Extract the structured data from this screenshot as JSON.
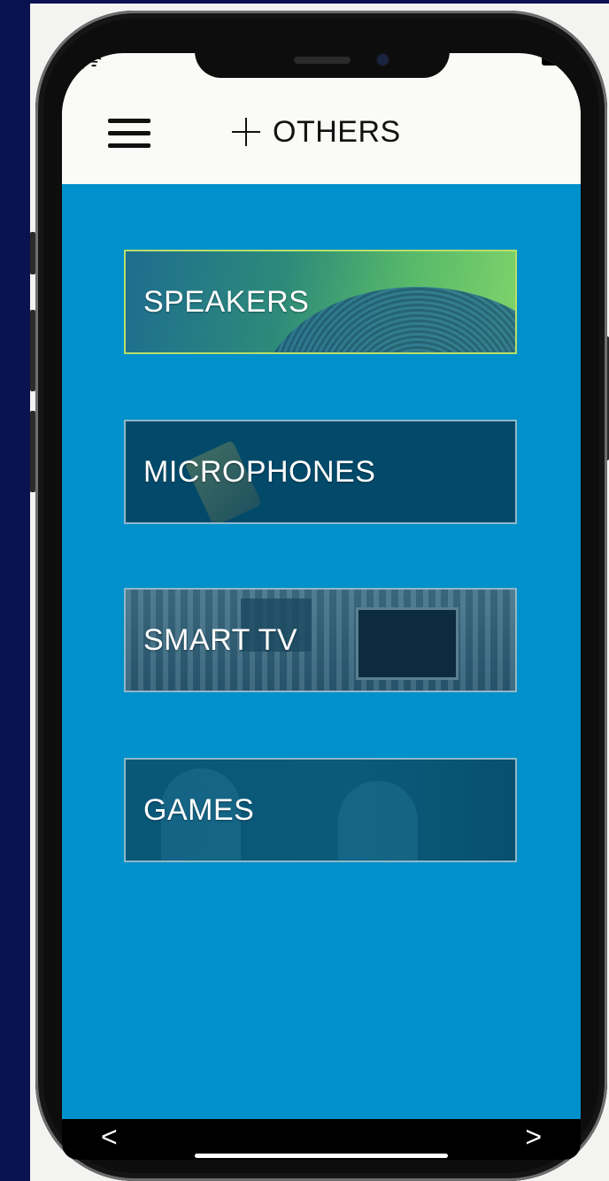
{
  "header": {
    "title": "OTHERS",
    "menu_icon": "hamburger-menu-icon",
    "add_icon": "plus-icon"
  },
  "categories": [
    {
      "label": "SPEAKERS"
    },
    {
      "label": "MICROPHONES"
    },
    {
      "label": "SMART TV"
    },
    {
      "label": "GAMES"
    }
  ],
  "navigation": {
    "back": "<",
    "forward": ">"
  },
  "colors": {
    "content_background": "#0090cb",
    "header_background": "#fafaf7",
    "page_background": "#0b1251"
  }
}
